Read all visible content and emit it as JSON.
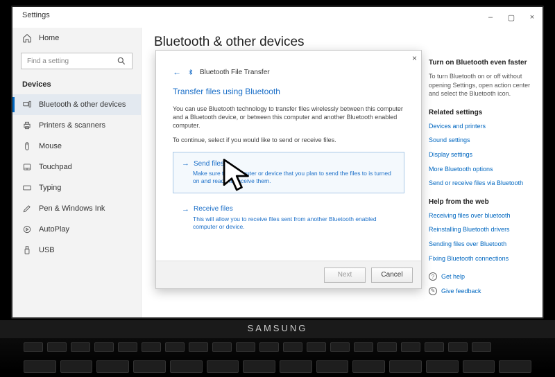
{
  "window": {
    "title": "Settings",
    "controls": {
      "min": "–",
      "max": "▢",
      "close": "×"
    }
  },
  "sidebar": {
    "home": "Home",
    "search_placeholder": "Find a setting",
    "section": "Devices",
    "items": [
      {
        "label": "Bluetooth & other devices",
        "active": true
      },
      {
        "label": "Printers & scanners",
        "active": false
      },
      {
        "label": "Mouse",
        "active": false
      },
      {
        "label": "Touchpad",
        "active": false
      },
      {
        "label": "Typing",
        "active": false
      },
      {
        "label": "Pen & Windows Ink",
        "active": false
      },
      {
        "label": "AutoPlay",
        "active": false
      },
      {
        "label": "USB",
        "active": false
      }
    ]
  },
  "main": {
    "page_title": "Bluetooth & other devices"
  },
  "right": {
    "tip_title": "Turn on Bluetooth even faster",
    "tip_body": "To turn Bluetooth on or off without opening Settings, open action center and select the Bluetooth icon.",
    "related_title": "Related settings",
    "related_links": [
      "Devices and printers",
      "Sound settings",
      "Display settings",
      "More Bluetooth options",
      "Send or receive files via Bluetooth"
    ],
    "help_title": "Help from the web",
    "help_links": [
      "Receiving files over bluetooth",
      "Reinstalling Bluetooth drivers",
      "Sending files over Bluetooth",
      "Fixing Bluetooth connections"
    ],
    "get_help": "Get help",
    "give_feedback": "Give feedback"
  },
  "dialog": {
    "wizard_name": "Bluetooth File Transfer",
    "heading": "Transfer files using Bluetooth",
    "desc": "You can use Bluetooth technology to transfer files wirelessly between this computer and a Bluetooth device, or between this computer and another Bluetooth enabled computer.",
    "instr": "To continue, select if you would like to send or receive files.",
    "options": [
      {
        "title": "Send files",
        "desc": "Make sure the computer or device that you plan to send the files to is turned on and ready to receive them."
      },
      {
        "title": "Receive files",
        "desc": "This will allow you to receive files sent from another Bluetooth enabled computer or device."
      }
    ],
    "buttons": {
      "next": "Next",
      "cancel": "Cancel"
    }
  },
  "laptop_brand": "SAMSUNG"
}
